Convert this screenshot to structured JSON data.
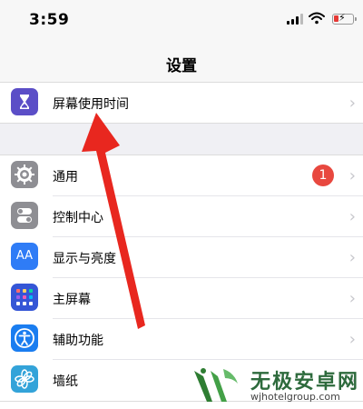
{
  "status": {
    "time": "3:59"
  },
  "nav": {
    "title": "设置"
  },
  "screen_time": {
    "label": "屏幕使用时间"
  },
  "settings": [
    {
      "label": "通用",
      "icon": "gear-icon",
      "color": "#8e8e93",
      "badge": "1"
    },
    {
      "label": "控制中心",
      "icon": "toggles-icon",
      "color": "#8e8e93"
    },
    {
      "label": "显示与亮度",
      "icon": "aa-icon",
      "color": "#2f7cf6",
      "icon_text": "AA"
    },
    {
      "label": "主屏幕",
      "icon": "home-grid-icon",
      "color": "#3556d6"
    },
    {
      "label": "辅助功能",
      "icon": "accessibility-icon",
      "color": "#1a7df0"
    },
    {
      "label": "墙纸",
      "icon": "flower-icon",
      "color": "#33a3d9"
    }
  ],
  "chevron": "›",
  "watermark": {
    "title": "无极安卓网",
    "url": "wjhotelgroup.com"
  },
  "colors": {
    "screen_time_icon": "#5b4ec7",
    "arrow": "#e8271f",
    "badge": "#e8483f"
  }
}
